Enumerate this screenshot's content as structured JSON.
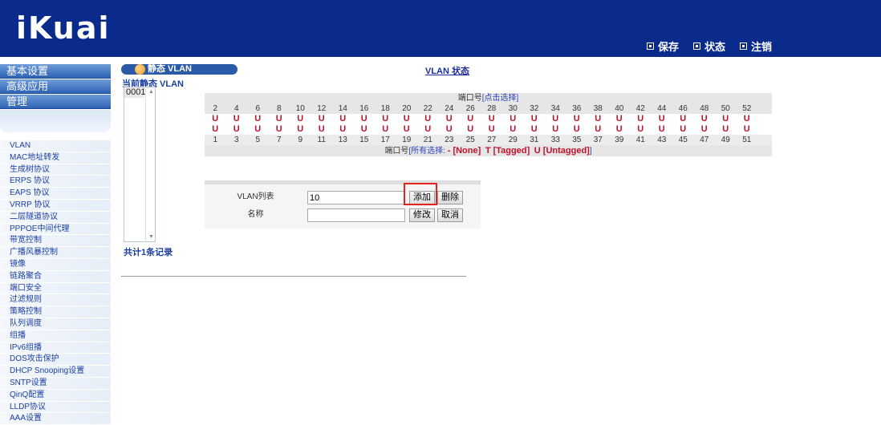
{
  "header": {
    "logo": "iKuai",
    "actions": [
      {
        "label": "保存",
        "icon": "save-icon"
      },
      {
        "label": "状态",
        "icon": "status-icon"
      },
      {
        "label": "注销",
        "icon": "logout-icon"
      }
    ]
  },
  "sidebar": {
    "sections": [
      "基本设置",
      "高级应用",
      "管理"
    ],
    "items": [
      "VLAN",
      "MAC地址转发",
      "生成树协议",
      "ERPS 协议",
      "EAPS 协议",
      "VRRP 协议",
      "二层隧道协议",
      "PPPOE中间代理",
      "带宽控制",
      "广播风暴控制",
      "镜像",
      "链路聚合",
      "端口安全",
      "过滤规则",
      "策略控制",
      "队列调度",
      "组播",
      "IPv6组播",
      "DOS攻击保护",
      "DHCP Snooping设置",
      "SNTP设置",
      "QinQ配置",
      "LLDP协议",
      "AAA设置"
    ]
  },
  "main": {
    "title": "静态 VLAN",
    "status_link": "VLAN 状态",
    "current_label": "当前静态 VLAN",
    "vlan_list": [
      "0001"
    ],
    "record_count": "共计1条记录",
    "ports": {
      "header_label": "端口号",
      "header_link": "[点击选择]",
      "even": [
        "2",
        "4",
        "6",
        "8",
        "10",
        "12",
        "14",
        "16",
        "18",
        "20",
        "22",
        "24",
        "26",
        "28",
        "30",
        "32",
        "34",
        "36",
        "38",
        "40",
        "42",
        "44",
        "46",
        "48",
        "50",
        "52"
      ],
      "odd": [
        "1",
        "3",
        "5",
        "7",
        "9",
        "11",
        "13",
        "15",
        "17",
        "19",
        "21",
        "23",
        "25",
        "27",
        "29",
        "31",
        "33",
        "35",
        "37",
        "39",
        "41",
        "43",
        "45",
        "47",
        "49",
        "51"
      ],
      "even_state": [
        "U",
        "U",
        "U",
        "U",
        "U",
        "U",
        "U",
        "U",
        "U",
        "U",
        "U",
        "U",
        "U",
        "U",
        "U",
        "U",
        "U",
        "U",
        "U",
        "U",
        "U",
        "U",
        "U",
        "U",
        "U",
        "U"
      ],
      "odd_state": [
        "U",
        "U",
        "U",
        "U",
        "U",
        "U",
        "U",
        "U",
        "U",
        "U",
        "U",
        "U",
        "U",
        "U",
        "U",
        "U",
        "U",
        "U",
        "U",
        "U",
        "U",
        "U",
        "U",
        "U",
        "U",
        "U"
      ],
      "legend_label": "端口号",
      "legend_link": "[所有选择:",
      "legend_none": "- [None]",
      "legend_tagged": "T [Tagged]",
      "legend_untagged": "U [Untagged]",
      "legend_close": "]"
    },
    "form": {
      "vlan_label": "VLAN列表",
      "vlan_value": "10",
      "name_label": "名称",
      "name_value": "",
      "add": "添加",
      "delete": "删除",
      "modify": "修改",
      "cancel": "取消"
    }
  }
}
